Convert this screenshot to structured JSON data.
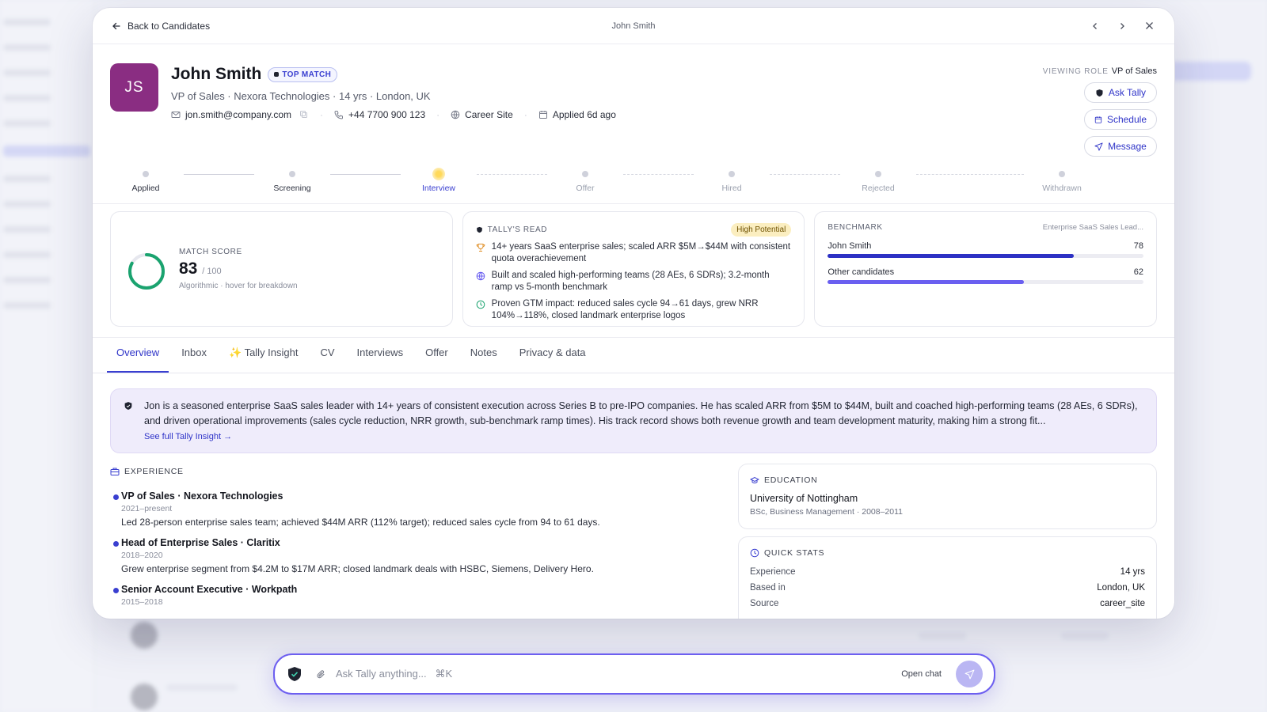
{
  "topbar": {
    "back_label": "Back to Candidates",
    "center_title": "John Smith"
  },
  "candidate": {
    "initials": "JS",
    "name": "John Smith",
    "badge": "TOP MATCH",
    "subline": "VP of Sales · Nexora Technologies · 14 yrs · London, UK",
    "email": "jon.smith@company.com",
    "phone": "+44 7700 900 123",
    "source": "Career Site",
    "applied": "Applied 6d ago"
  },
  "role": {
    "label": "VIEWING ROLE",
    "value": "VP of Sales"
  },
  "actions": {
    "ask": "Ask Tally",
    "schedule": "Schedule",
    "message": "Message"
  },
  "pipeline": {
    "stages": [
      {
        "label": "Applied",
        "state": "done"
      },
      {
        "label": "Screening",
        "state": "done"
      },
      {
        "label": "Interview",
        "state": "active"
      },
      {
        "label": "Offer",
        "state": "todo"
      },
      {
        "label": "Hired",
        "state": "todo"
      },
      {
        "label": "Rejected",
        "state": "todo"
      },
      {
        "label": "Withdrawn",
        "state": "todo"
      }
    ]
  },
  "score": {
    "label": "MATCH SCORE",
    "value": "83",
    "max": "/ 100",
    "hint": "Algorithmic · hover for breakdown",
    "fraction": 0.83,
    "color": "#1aa36f"
  },
  "tally_read": {
    "label": "TALLY'S READ",
    "tag": "High Potential",
    "bullets": [
      {
        "icon": "trophy-icon",
        "text": "14+ years SaaS enterprise sales; scaled ARR $5M→$44M with consistent quota overachievement"
      },
      {
        "icon": "globe-icon",
        "text": "Built and scaled high-performing teams (28 AEs, 6 SDRs); 3.2-month ramp vs 5-month benchmark"
      },
      {
        "icon": "clock-icon",
        "text": "Proven GTM impact: reduced sales cycle 94→61 days, grew NRR 104%→118%, closed landmark enterprise logos"
      }
    ]
  },
  "benchmark": {
    "label": "BENCHMARK",
    "context": "Enterprise SaaS Sales Lead...",
    "rows": [
      {
        "name": "John Smith",
        "value": "78",
        "fraction": 0.78,
        "color": "#2d31c4"
      },
      {
        "name": "Other candidates",
        "value": "62",
        "fraction": 0.62,
        "color": "#6a5ff0"
      }
    ]
  },
  "tabs": [
    {
      "label": "Overview",
      "active": true
    },
    {
      "label": "Inbox"
    },
    {
      "label": "✨ Tally Insight"
    },
    {
      "label": "CV"
    },
    {
      "label": "Interviews"
    },
    {
      "label": "Offer"
    },
    {
      "label": "Notes"
    },
    {
      "label": "Privacy & data"
    }
  ],
  "insight": {
    "text": "Jon is a seasoned enterprise SaaS sales leader with 14+ years of consistent execution across Series B to pre-IPO companies. He has scaled ARR from $5M to $44M, built and coached high-performing teams (28 AEs, 6 SDRs), and driven operational improvements (sales cycle reduction, NRR growth, sub-benchmark ramp times). His track record shows both revenue growth and team development maturity, making him a strong fit...",
    "link": "See full Tally Insight →"
  },
  "experience": {
    "label": "EXPERIENCE",
    "jobs": [
      {
        "title": "VP of Sales · Nexora Technologies",
        "years": "2021–present",
        "desc": "Led 28-person enterprise sales team; achieved $44M ARR (112% target); reduced sales cycle from 94 to 61 days."
      },
      {
        "title": "Head of Enterprise Sales · Claritix",
        "years": "2018–2020",
        "desc": "Grew enterprise segment from $4.2M to $17M ARR; closed landmark deals with HSBC, Siemens, Delivery Hero."
      },
      {
        "title": "Senior Account Executive · Workpath",
        "years": "2015–2018",
        "desc": ""
      }
    ]
  },
  "education": {
    "label": "EDUCATION",
    "school": "University of Nottingham",
    "degree": "BSc, Business Management · 2008–2011"
  },
  "quick_stats": {
    "label": "QUICK STATS",
    "rows": [
      {
        "k": "Experience",
        "v": "14 yrs"
      },
      {
        "k": "Based in",
        "v": "London, UK"
      },
      {
        "k": "Source",
        "v": "career_site"
      }
    ]
  },
  "chat": {
    "placeholder": "Ask Tally anything...",
    "shortcut": "⌘K",
    "open_label": "Open chat"
  }
}
